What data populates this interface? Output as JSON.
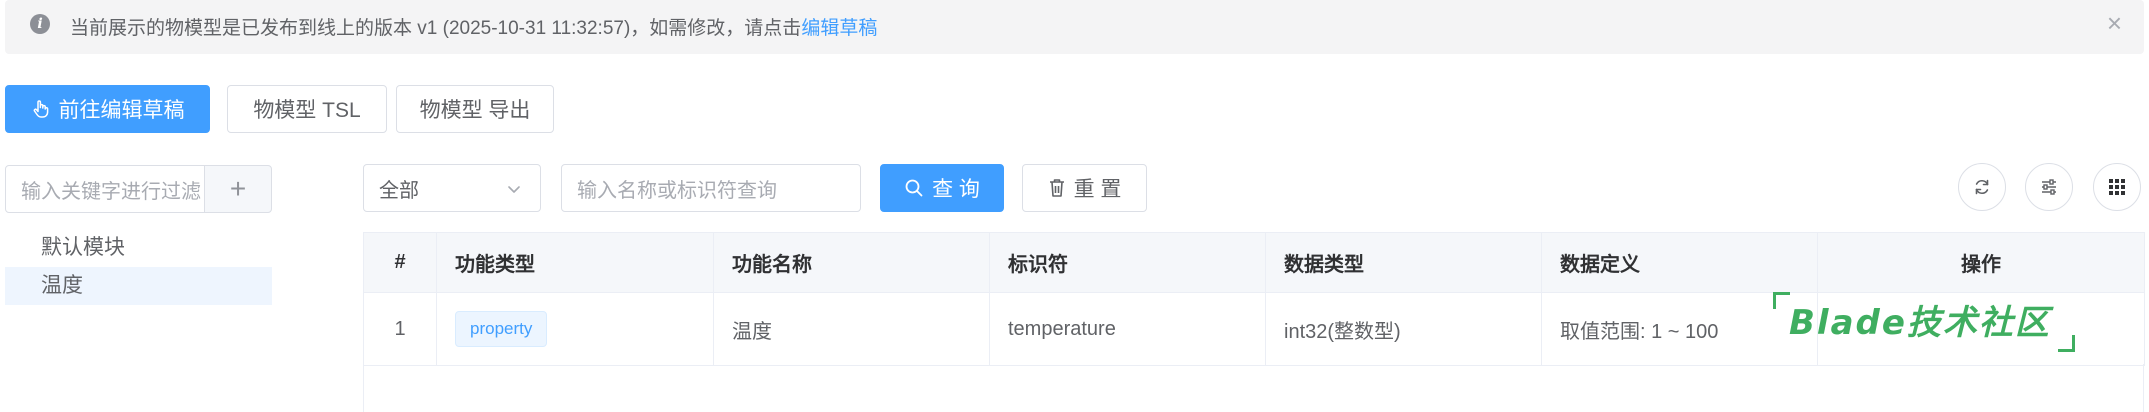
{
  "alert": {
    "message": "当前展示的物模型是已发布到线上的版本 v1 (2025-10-31 11:32:57)，如需修改，请点击",
    "link_text": "编辑草稿",
    "close_symbol": "×"
  },
  "toolbar": {
    "edit_draft_label": "前往编辑草稿",
    "tsl_label": "物模型 TSL",
    "export_label": "物模型 导出"
  },
  "sidebar": {
    "search_placeholder": "输入关键字进行过滤",
    "add_symbol": "+",
    "items": [
      {
        "label": "默认模块",
        "active": false
      },
      {
        "label": "温度",
        "active": true
      }
    ]
  },
  "filters": {
    "select_value": "全部",
    "search_placeholder": "输入名称或标识符查询",
    "query_label": "查 询",
    "reset_label": "重 置"
  },
  "table": {
    "columns": [
      "#",
      "功能类型",
      "功能名称",
      "标识符",
      "数据类型",
      "数据定义",
      "操作"
    ],
    "rows": [
      {
        "index": "1",
        "type": "property",
        "name": "温度",
        "identifier": "temperature",
        "data_type": "int32(整数型)",
        "definition": "取值范围: 1 ~ 100"
      }
    ]
  },
  "watermark": {
    "text": "Blade技术社区"
  },
  "colors": {
    "primary": "#409eff",
    "watermark": "#3fae60"
  }
}
